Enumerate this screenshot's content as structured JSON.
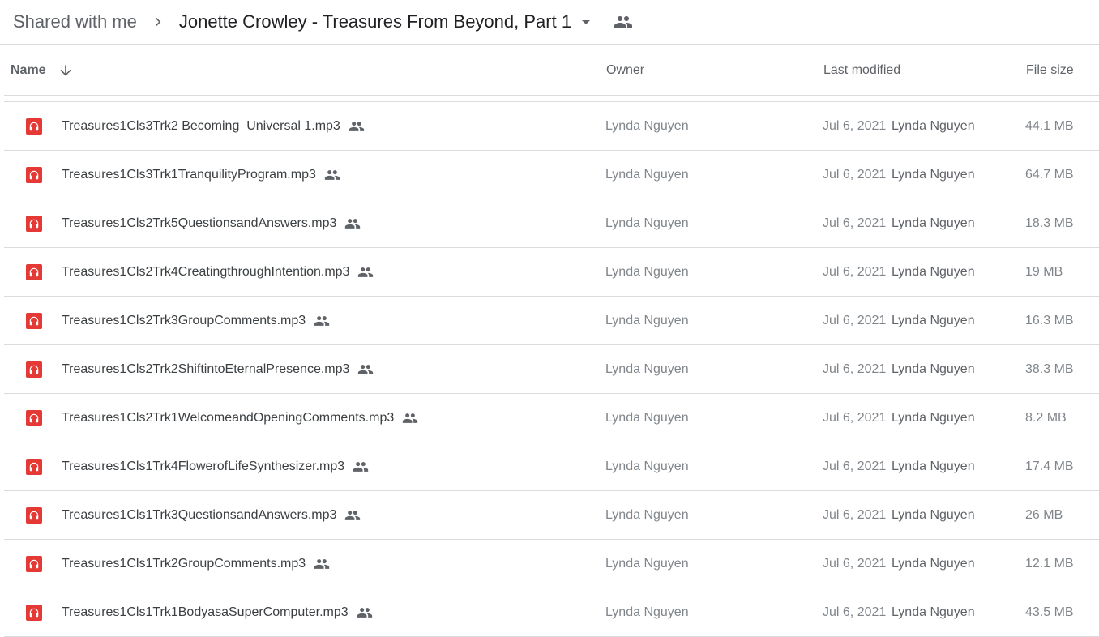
{
  "breadcrumb": {
    "root": "Shared with me",
    "current": "Jonette Crowley - Treasures From Beyond, Part 1",
    "separator_icon": "chevron-right-icon",
    "dropdown_icon": "arrow-drop-down-icon",
    "shared_icon": "people-icon"
  },
  "columns": {
    "name": "Name",
    "owner": "Owner",
    "last_modified": "Last modified",
    "file_size": "File size",
    "sort_icon": "arrow-down-icon"
  },
  "colors": {
    "audio_icon": "#e53935",
    "divider": "#dadce0",
    "muted_text": "#80868b"
  },
  "files": [
    {
      "name": "Treasures1Cls3Trk2 Becoming  Universal 1.mp3",
      "owner": "Lynda Nguyen",
      "date": "Jul 6, 2021",
      "modified_by": "Lynda Nguyen",
      "size": "44.1 MB"
    },
    {
      "name": "Treasures1Cls3Trk1TranquilityProgram.mp3",
      "owner": "Lynda Nguyen",
      "date": "Jul 6, 2021",
      "modified_by": "Lynda Nguyen",
      "size": "64.7 MB"
    },
    {
      "name": "Treasures1Cls2Trk5QuestionsandAnswers.mp3",
      "owner": "Lynda Nguyen",
      "date": "Jul 6, 2021",
      "modified_by": "Lynda Nguyen",
      "size": "18.3 MB"
    },
    {
      "name": "Treasures1Cls2Trk4CreatingthroughIntention.mp3",
      "owner": "Lynda Nguyen",
      "date": "Jul 6, 2021",
      "modified_by": "Lynda Nguyen",
      "size": "19 MB"
    },
    {
      "name": "Treasures1Cls2Trk3GroupComments.mp3",
      "owner": "Lynda Nguyen",
      "date": "Jul 6, 2021",
      "modified_by": "Lynda Nguyen",
      "size": "16.3 MB"
    },
    {
      "name": "Treasures1Cls2Trk2ShiftintoEternalPresence.mp3",
      "owner": "Lynda Nguyen",
      "date": "Jul 6, 2021",
      "modified_by": "Lynda Nguyen",
      "size": "38.3 MB"
    },
    {
      "name": "Treasures1Cls2Trk1WelcomeandOpeningComments.mp3",
      "owner": "Lynda Nguyen",
      "date": "Jul 6, 2021",
      "modified_by": "Lynda Nguyen",
      "size": "8.2 MB"
    },
    {
      "name": "Treasures1Cls1Trk4FlowerofLifeSynthesizer.mp3",
      "owner": "Lynda Nguyen",
      "date": "Jul 6, 2021",
      "modified_by": "Lynda Nguyen",
      "size": "17.4 MB"
    },
    {
      "name": "Treasures1Cls1Trk3QuestionsandAnswers.mp3",
      "owner": "Lynda Nguyen",
      "date": "Jul 6, 2021",
      "modified_by": "Lynda Nguyen",
      "size": "26 MB"
    },
    {
      "name": "Treasures1Cls1Trk2GroupComments.mp3",
      "owner": "Lynda Nguyen",
      "date": "Jul 6, 2021",
      "modified_by": "Lynda Nguyen",
      "size": "12.1 MB"
    },
    {
      "name": "Treasures1Cls1Trk1BodyasaSuperComputer.mp3",
      "owner": "Lynda Nguyen",
      "date": "Jul 6, 2021",
      "modified_by": "Lynda Nguyen",
      "size": "43.5 MB"
    }
  ]
}
